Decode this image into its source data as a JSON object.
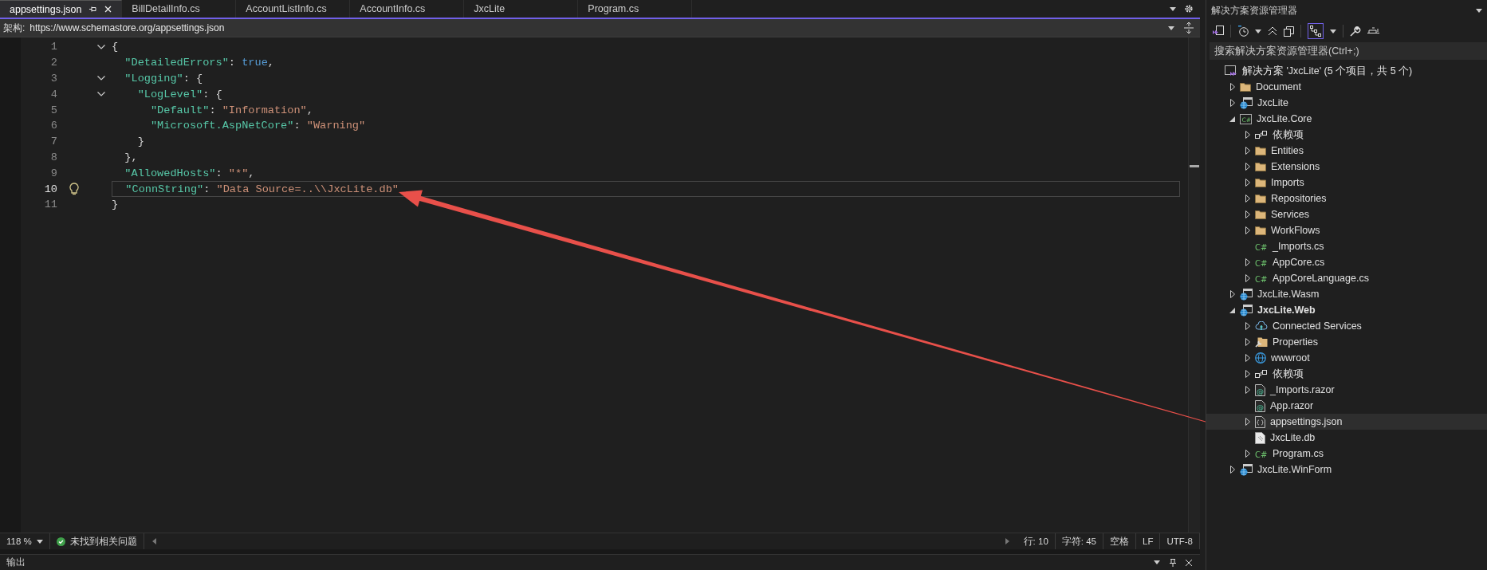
{
  "tabs": [
    {
      "label": "appsettings.json",
      "selected": true
    },
    {
      "label": "BillDetailInfo.cs",
      "selected": false
    },
    {
      "label": "AccountListInfo.cs",
      "selected": false
    },
    {
      "label": "AccountInfo.cs",
      "selected": false
    },
    {
      "label": "JxcLite",
      "selected": false
    },
    {
      "label": "Program.cs",
      "selected": false
    }
  ],
  "navigation_bar": {
    "label": "架构:",
    "value": "https://www.schemastore.org/appsettings.json"
  },
  "editor": {
    "lines": [
      {
        "number": "1",
        "fold": true,
        "current": false,
        "lightbulb": false,
        "tokens": [
          {
            "kind": "punct",
            "text": "{"
          }
        ]
      },
      {
        "number": "2",
        "fold": false,
        "current": false,
        "lightbulb": false,
        "tokens": [
          {
            "kind": "key",
            "text": "  \"DetailedErrors\""
          },
          {
            "kind": "punct",
            "text": ": "
          },
          {
            "kind": "bool",
            "text": "true"
          },
          {
            "kind": "punct",
            "text": ","
          }
        ]
      },
      {
        "number": "3",
        "fold": true,
        "current": false,
        "lightbulb": false,
        "tokens": [
          {
            "kind": "key",
            "text": "  \"Logging\""
          },
          {
            "kind": "punct",
            "text": ": {"
          }
        ]
      },
      {
        "number": "4",
        "fold": true,
        "current": false,
        "lightbulb": false,
        "tokens": [
          {
            "kind": "key",
            "text": "    \"LogLevel\""
          },
          {
            "kind": "punct",
            "text": ": {"
          }
        ]
      },
      {
        "number": "5",
        "fold": false,
        "current": false,
        "lightbulb": false,
        "tokens": [
          {
            "kind": "key",
            "text": "      \"Default\""
          },
          {
            "kind": "punct",
            "text": ": "
          },
          {
            "kind": "string",
            "text": "\"Information\""
          },
          {
            "kind": "punct",
            "text": ","
          }
        ]
      },
      {
        "number": "6",
        "fold": false,
        "current": false,
        "lightbulb": false,
        "tokens": [
          {
            "kind": "key",
            "text": "      \"Microsoft.AspNetCore\""
          },
          {
            "kind": "punct",
            "text": ": "
          },
          {
            "kind": "string",
            "text": "\"Warning\""
          }
        ]
      },
      {
        "number": "7",
        "fold": false,
        "current": false,
        "lightbulb": false,
        "tokens": [
          {
            "kind": "punct",
            "text": "    }"
          }
        ]
      },
      {
        "number": "8",
        "fold": false,
        "current": false,
        "lightbulb": false,
        "tokens": [
          {
            "kind": "punct",
            "text": "  },"
          }
        ]
      },
      {
        "number": "9",
        "fold": false,
        "current": false,
        "lightbulb": false,
        "tokens": [
          {
            "kind": "key",
            "text": "  \"AllowedHosts\""
          },
          {
            "kind": "punct",
            "text": ": "
          },
          {
            "kind": "string",
            "text": "\"*\""
          },
          {
            "kind": "punct",
            "text": ","
          }
        ]
      },
      {
        "number": "10",
        "fold": false,
        "current": true,
        "lightbulb": true,
        "tokens": [
          {
            "kind": "key",
            "text": "  \"ConnString\""
          },
          {
            "kind": "punct",
            "text": ": "
          },
          {
            "kind": "string",
            "text": "\"Data Source=..\\\\JxcLite.db\""
          }
        ]
      },
      {
        "number": "11",
        "fold": false,
        "current": false,
        "lightbulb": false,
        "tokens": [
          {
            "kind": "punct",
            "text": "}"
          }
        ]
      }
    ]
  },
  "status_bar": {
    "zoom": "118 %",
    "issues": "未找到相关问题",
    "line": "行: 10",
    "column": "字符: 45",
    "whitespace": "空格",
    "line_ending": "LF",
    "encoding": "UTF-8"
  },
  "output_panel": {
    "title": "输出"
  },
  "solution_explorer": {
    "title": "解决方案资源管理器",
    "search": {
      "placeholder": "搜索解决方案资源管理器(Ctrl+;)"
    },
    "tree": [
      {
        "label": "解决方案 'JxcLite' (5 个项目，共 5 个)",
        "kind": "solution",
        "selected": false,
        "startup": false,
        "children": [
          {
            "label": "Document",
            "kind": "folder",
            "expanded": false,
            "selected": false,
            "startup": false
          },
          {
            "label": "JxcLite",
            "kind": "web",
            "expanded": false,
            "selected": false,
            "startup": false
          },
          {
            "label": "JxcLite.Core",
            "kind": "project",
            "icon_text": "C#",
            "expanded": true,
            "selected": false,
            "startup": false,
            "children": [
              {
                "label": "依赖项",
                "kind": "dependencies",
                "expanded": false,
                "selected": false,
                "startup": false
              },
              {
                "label": "Entities",
                "kind": "folder",
                "expanded": false,
                "selected": false,
                "startup": false
              },
              {
                "label": "Extensions",
                "kind": "folder",
                "expanded": false,
                "selected": false,
                "startup": false
              },
              {
                "label": "Imports",
                "kind": "folder",
                "expanded": false,
                "selected": false,
                "startup": false
              },
              {
                "label": "Repositories",
                "kind": "folder",
                "expanded": false,
                "selected": false,
                "startup": false
              },
              {
                "label": "Services",
                "kind": "folder",
                "expanded": false,
                "selected": false,
                "startup": false
              },
              {
                "label": "WorkFlows",
                "kind": "folder",
                "expanded": false,
                "selected": false,
                "startup": false
              },
              {
                "label": "_Imports.cs",
                "kind": "code",
                "icon_text": "C#",
                "selected": false,
                "startup": false
              },
              {
                "label": "AppCore.cs",
                "kind": "code",
                "icon_text": "C#",
                "expanded": false,
                "selected": false,
                "startup": false
              },
              {
                "label": "AppCoreLanguage.cs",
                "kind": "code",
                "icon_text": "C#",
                "expanded": false,
                "selected": false,
                "startup": false
              }
            ]
          },
          {
            "label": "JxcLite.Wasm",
            "kind": "web",
            "expanded": false,
            "selected": false,
            "startup": false
          },
          {
            "label": "JxcLite.Web",
            "kind": "web",
            "expanded": true,
            "selected": false,
            "startup": true,
            "children": [
              {
                "label": "Connected Services",
                "kind": "connected",
                "expanded": false,
                "selected": false,
                "startup": false
              },
              {
                "label": "Properties",
                "kind": "properties",
                "expanded": false,
                "selected": false,
                "startup": false
              },
              {
                "label": "wwwroot",
                "kind": "globe",
                "expanded": false,
                "selected": false,
                "startup": false
              },
              {
                "label": "依赖项",
                "kind": "dependencies",
                "expanded": false,
                "selected": false,
                "startup": false
              },
              {
                "label": "_Imports.razor",
                "kind": "razor",
                "icon_text": "@",
                "expanded": false,
                "selected": false,
                "startup": false
              },
              {
                "label": "App.razor",
                "kind": "razor",
                "icon_text": "@",
                "selected": false,
                "startup": false
              },
              {
                "label": "appsettings.json",
                "kind": "json",
                "expanded": false,
                "selected": true,
                "startup": false
              },
              {
                "label": "JxcLite.db",
                "kind": "db",
                "selected": false,
                "startup": false
              },
              {
                "label": "Program.cs",
                "kind": "code",
                "icon_text": "C#",
                "expanded": false,
                "selected": false,
                "startup": false
              }
            ]
          },
          {
            "label": "JxcLite.WinForm",
            "kind": "web",
            "expanded": false,
            "selected": false,
            "startup": false
          }
        ]
      }
    ]
  }
}
